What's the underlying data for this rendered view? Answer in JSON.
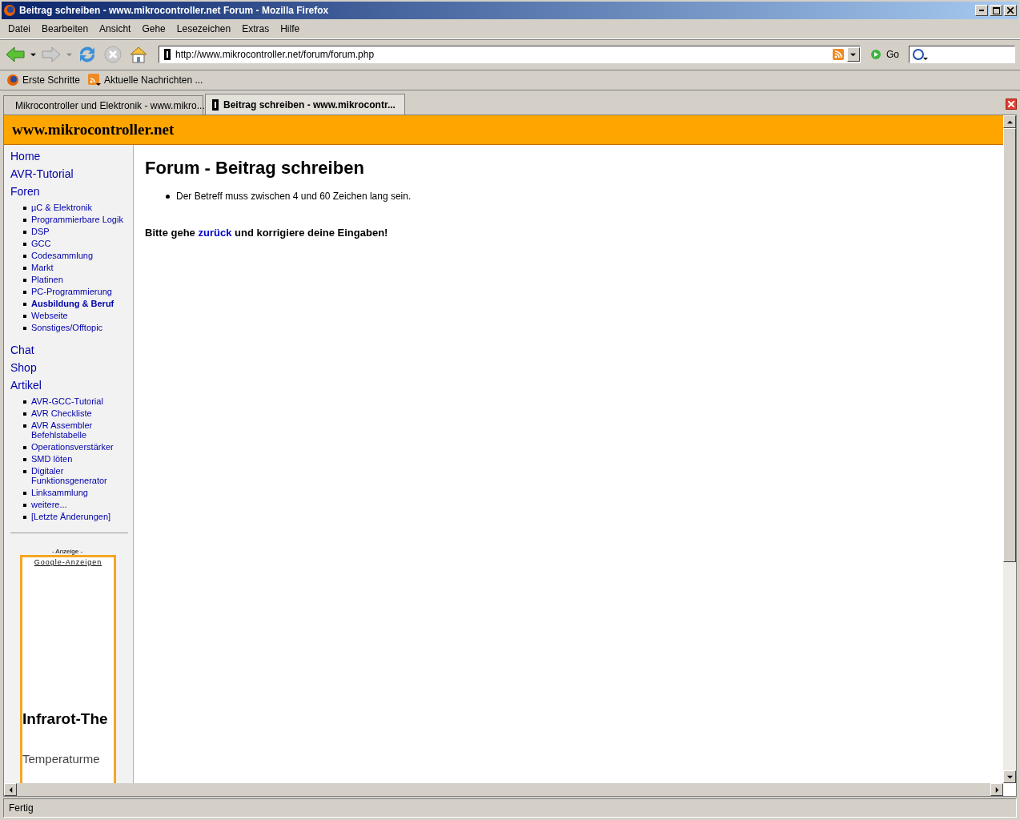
{
  "window": {
    "title": "Beitrag schreiben - www.mikrocontroller.net Forum - Mozilla Firefox"
  },
  "menu": [
    "Datei",
    "Bearbeiten",
    "Ansicht",
    "Gehe",
    "Lesezeichen",
    "Extras",
    "Hilfe"
  ],
  "toolbar": {
    "url": "http://www.mikrocontroller.net/forum/forum.php",
    "go": "Go"
  },
  "bookmarks": [
    "Erste Schritte",
    "Aktuelle Nachrichten ..."
  ],
  "tabs": [
    {
      "label": "Mikrocontroller und Elektronik - www.mikro...",
      "selected": false
    },
    {
      "label": "Beitrag schreiben - www.mikrocontr...",
      "selected": true
    }
  ],
  "page": {
    "site_title": "www.mikrocontroller.net",
    "nav": [
      {
        "label": "Home"
      },
      {
        "label": "AVR-Tutorial"
      },
      {
        "label": "Foren",
        "children": [
          {
            "label": "µC & Elektronik",
            "selected": false
          },
          {
            "label": "Programmierbare Logik",
            "selected": false
          },
          {
            "label": "DSP",
            "selected": false
          },
          {
            "label": "GCC",
            "selected": false
          },
          {
            "label": "Codesammlung",
            "selected": false
          },
          {
            "label": "Markt",
            "selected": false
          },
          {
            "label": "Platinen",
            "selected": false
          },
          {
            "label": "PC-Programmierung",
            "selected": false
          },
          {
            "label": "Ausbildung & Beruf",
            "selected": true
          },
          {
            "label": "Webseite",
            "selected": false
          },
          {
            "label": "Sonstiges/Offtopic",
            "selected": false
          }
        ]
      },
      {
        "label": "Chat"
      },
      {
        "label": "Shop"
      },
      {
        "label": "Artikel",
        "children": [
          {
            "label": "AVR-GCC-Tutorial",
            "selected": false
          },
          {
            "label": "AVR Checkliste",
            "selected": false
          },
          {
            "label": "AVR Assembler Befehlstabelle",
            "selected": false
          },
          {
            "label": "Operationsverstärker",
            "selected": false
          },
          {
            "label": "SMD löten",
            "selected": false
          },
          {
            "label": "Digitaler Funktionsgenerator",
            "selected": false
          },
          {
            "label": "Linksammlung",
            "selected": false
          },
          {
            "label": "weitere...",
            "selected": false
          },
          {
            "label": "[Letzte Änderungen]",
            "selected": false
          }
        ]
      }
    ],
    "ad": {
      "label": "- Anzeige -",
      "link": "Google-Anzeigen",
      "headline": "Infrarot-The",
      "text": "Temperaturme"
    },
    "heading": "Forum - Beitrag schreiben",
    "errors": [
      "Der Betreff muss zwischen 4 und 60 Zeichen lang sein."
    ],
    "note": {
      "before": "Bitte gehe",
      "link": "zurück",
      "after": "und korrigiere deine Eingaben!"
    }
  },
  "status_bar": "Fertig"
}
